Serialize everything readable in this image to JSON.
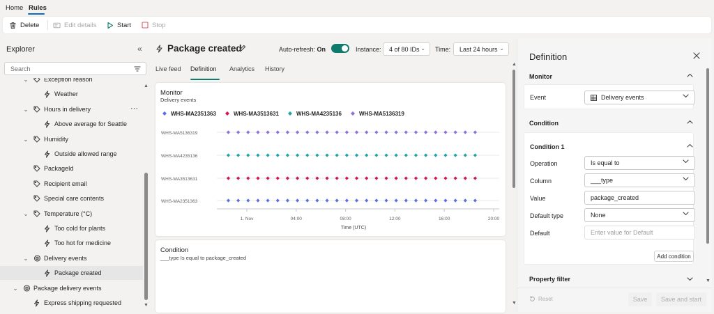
{
  "top_tabs": {
    "home": "Home",
    "rules": "Rules"
  },
  "toolbar": {
    "delete": "Delete",
    "edit_details": "Edit details",
    "start": "Start",
    "stop": "Stop"
  },
  "explorer": {
    "title": "Explorer",
    "search_placeholder": "Search",
    "items": [
      {
        "label": "Exception reason"
      },
      {
        "label": "Weather"
      },
      {
        "label": "Hours in delivery"
      },
      {
        "label": "Above average for Seattle"
      },
      {
        "label": "Humidity"
      },
      {
        "label": "Outside allowed range"
      },
      {
        "label": "PackageId"
      },
      {
        "label": "Recipient email"
      },
      {
        "label": "Special care contents"
      },
      {
        "label": "Temperature (°C)"
      },
      {
        "label": "Too cold for plants"
      },
      {
        "label": "Too hot for medicine"
      },
      {
        "label": "Delivery events"
      },
      {
        "label": "Package created"
      },
      {
        "label": "Package delivery events"
      },
      {
        "label": "Express shipping requested"
      }
    ]
  },
  "rule": {
    "title": "Package created",
    "auto_refresh_label": "Auto-refresh:",
    "auto_refresh_value": "On",
    "instance_label": "Instance:",
    "instance_value": "4 of 80 IDs",
    "time_label": "Time:",
    "time_value": "Last 24 hours",
    "tabs": [
      "Live feed",
      "Definition",
      "Analytics",
      "History"
    ]
  },
  "monitor_card": {
    "title": "Monitor",
    "subtitle": "Delivery events"
  },
  "chart_data": {
    "type": "scatter",
    "title": "Monitor",
    "subtitle": "Delivery events",
    "xlabel": "Time (UTC)",
    "xticks": [
      "1. Nov",
      "04:00",
      "08:00",
      "12:00",
      "16:00",
      "20:00"
    ],
    "categories": [
      "WHS-MA5136319",
      "WHS-MA4235136",
      "WHS-MA3513631",
      "WHS-MA2351363"
    ],
    "legend": [
      "WHS-MA2351363",
      "WHS-MA3513631",
      "WHS-MA4235136",
      "WHS-MA5136319"
    ],
    "colors": {
      "WHS-MA2351363": "#5b6fe6",
      "WHS-MA3513631": "#d4145a",
      "WHS-MA4235136": "#1aa6a6",
      "WHS-MA5136319": "#8a6fd6"
    },
    "series": [
      {
        "name": "WHS-MA5136319",
        "row": 0,
        "count": 26,
        "x_start_hour": -1.5,
        "step_hours": 0.8
      },
      {
        "name": "WHS-MA4235136",
        "row": 1,
        "count": 26,
        "x_start_hour": -1.5,
        "step_hours": 0.8
      },
      {
        "name": "WHS-MA3513631",
        "row": 2,
        "count": 26,
        "x_start_hour": -1.5,
        "step_hours": 0.8
      },
      {
        "name": "WHS-MA2351363",
        "row": 3,
        "count": 26,
        "x_start_hour": -1.5,
        "step_hours": 0.8
      }
    ]
  },
  "condition_card": {
    "title": "Condition",
    "text": "___type Is equal to package_created"
  },
  "definition": {
    "title": "Definition",
    "monitor": "Monitor",
    "event_label": "Event",
    "event_value": "Delivery events",
    "condition": "Condition",
    "condition1": "Condition 1",
    "operation_label": "Operation",
    "operation_value": "Is equal to",
    "column_label": "Column",
    "column_value": "___type",
    "value_label": "Value",
    "value_value": "package_created",
    "default_type_label": "Default type",
    "default_type_value": "None",
    "default_label": "Default",
    "default_placeholder": "Enter value for Default",
    "add_condition": "Add condition",
    "property_filter": "Property filter",
    "reset": "Reset",
    "save": "Save",
    "save_and_start": "Save and start"
  }
}
